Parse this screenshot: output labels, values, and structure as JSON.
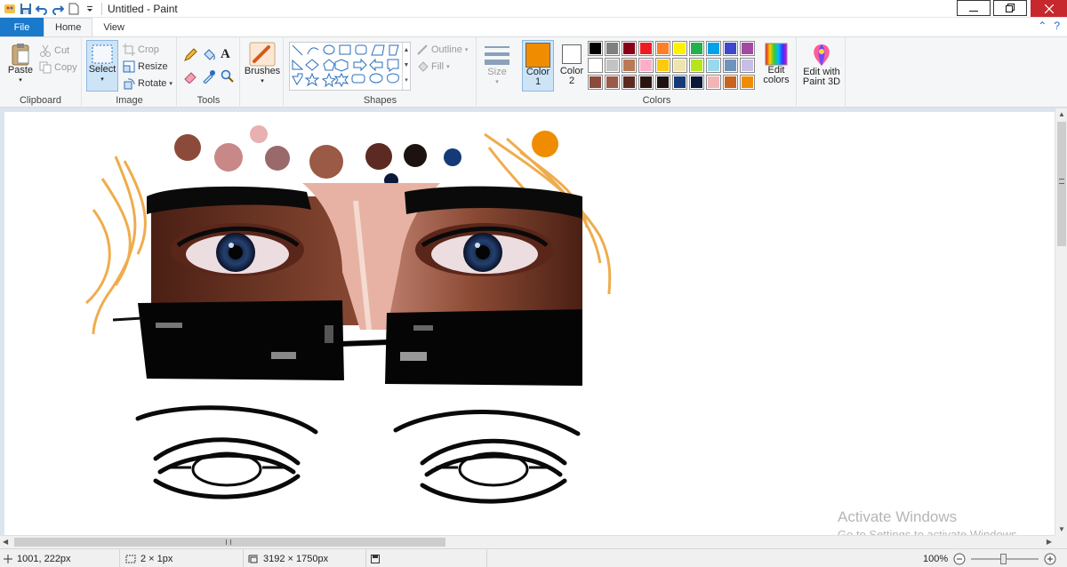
{
  "window": {
    "title": "Untitled - Paint"
  },
  "tabs": {
    "file": "File",
    "home": "Home",
    "view": "View"
  },
  "clipboard": {
    "paste": "Paste",
    "cut": "Cut",
    "copy": "Copy",
    "label": "Clipboard"
  },
  "image": {
    "select": "Select",
    "crop": "Crop",
    "resize": "Resize",
    "rotate": "Rotate",
    "label": "Image"
  },
  "tools": {
    "label": "Tools"
  },
  "brushes": {
    "label": "Brushes"
  },
  "shapes": {
    "outline": "Outline",
    "fill": "Fill",
    "label": "Shapes"
  },
  "size": {
    "label": "Size"
  },
  "colors": {
    "color1_label": "Color",
    "color1_num": "1",
    "color2_label": "Color",
    "color2_num": "2",
    "color1_value": "#f08c00",
    "color2_value": "#ffffff",
    "edit_colors_line1": "Edit",
    "edit_colors_line2": "colors",
    "label": "Colors",
    "palette_row1": [
      "#000000",
      "#7f7f7f",
      "#880015",
      "#ed1c24",
      "#ff7f27",
      "#fff200",
      "#22b14c",
      "#00a2e8",
      "#3f48cc",
      "#a349a4"
    ],
    "palette_row2": [
      "#ffffff",
      "#c3c3c3",
      "#b97a57",
      "#ffaec9",
      "#ffc90e",
      "#efe4b0",
      "#b5e61d",
      "#99d9ea",
      "#7092be",
      "#c8bfe7"
    ],
    "palette_row3": [
      "#8c4a3a",
      "#9a5a45",
      "#5c2a22",
      "#2b1410",
      "#1c1210",
      "#143b78",
      "#0c1838",
      "#f2b5b5",
      "#c8641c",
      "#f08c00"
    ]
  },
  "paint3d": {
    "line1": "Edit with",
    "line2": "Paint 3D"
  },
  "status": {
    "cursor": "1001, 222px",
    "selection": "2 × 1px",
    "image_size": "3192 × 1750px",
    "zoom": "100%"
  },
  "watermark": {
    "title": "Activate Windows",
    "subtitle": "Go to Settings to activate Windows."
  }
}
